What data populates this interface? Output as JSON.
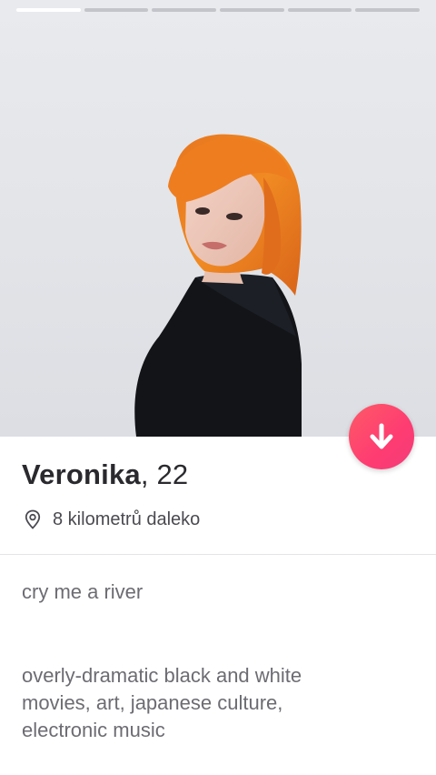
{
  "profile": {
    "name": "Veronika",
    "age_text": ", 22",
    "distance": "8 kilometrů daleko",
    "bio_lines": [
      "cry me a river"
    ],
    "interests_lines": [
      "overly-dramatic black and white",
      "movies, art, japanese culture,",
      "electronic music"
    ]
  },
  "photo_progress": {
    "total": 6,
    "active_index": 0
  },
  "icons": {
    "location": "location-pin-icon",
    "down": "arrow-down-icon"
  },
  "colors": {
    "accent": "#fe3c72",
    "text_dark": "#2a2a2e",
    "text_muted": "#6c6c72"
  }
}
